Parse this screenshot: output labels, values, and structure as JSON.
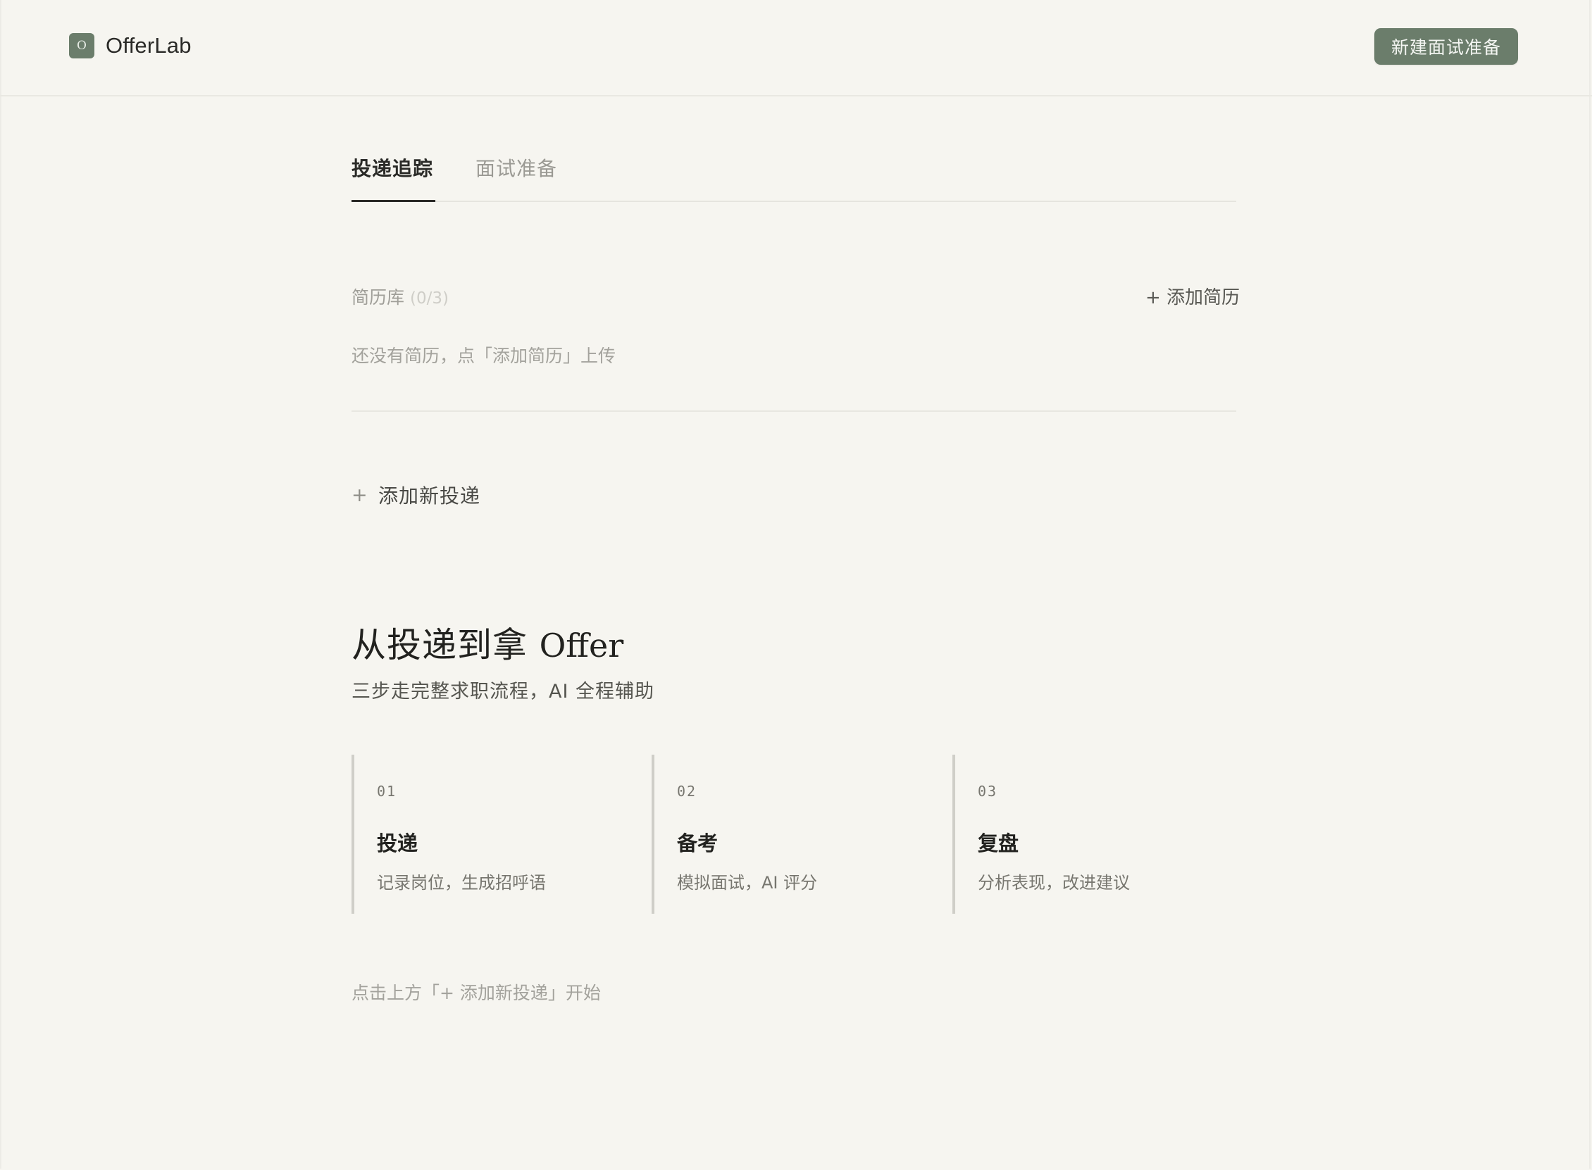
{
  "header": {
    "logo_letter": "O",
    "app_name": "OfferLab",
    "new_button_label": "新建面试准备"
  },
  "tabs": [
    {
      "label": "投递追踪",
      "active": true
    },
    {
      "label": "面试准备",
      "active": false
    }
  ],
  "resume": {
    "title": "简历库",
    "count": "(0/3)",
    "add_label": "+ 添加简历",
    "empty_text": "还没有简历，点「添加简历」上传"
  },
  "add_submission": {
    "plus": "+",
    "label": "添加新投递"
  },
  "hero": {
    "title_main": "从投递到拿 ",
    "title_offer": "Offer",
    "subtitle": "三步走完整求职流程，AI 全程辅助"
  },
  "steps": [
    {
      "num": "01",
      "title": "投递",
      "desc": "记录岗位，生成招呼语"
    },
    {
      "num": "02",
      "title": "备考",
      "desc": "模拟面试，AI 评分"
    },
    {
      "num": "03",
      "title": "复盘",
      "desc": "分析表现，改进建议"
    }
  ],
  "hint": "点击上方「+ 添加新投递」开始",
  "colors": {
    "accent": "#6b7d6b",
    "background": "#f6f5f0",
    "text_primary": "#2a2a27",
    "text_muted": "#a3a29c"
  }
}
